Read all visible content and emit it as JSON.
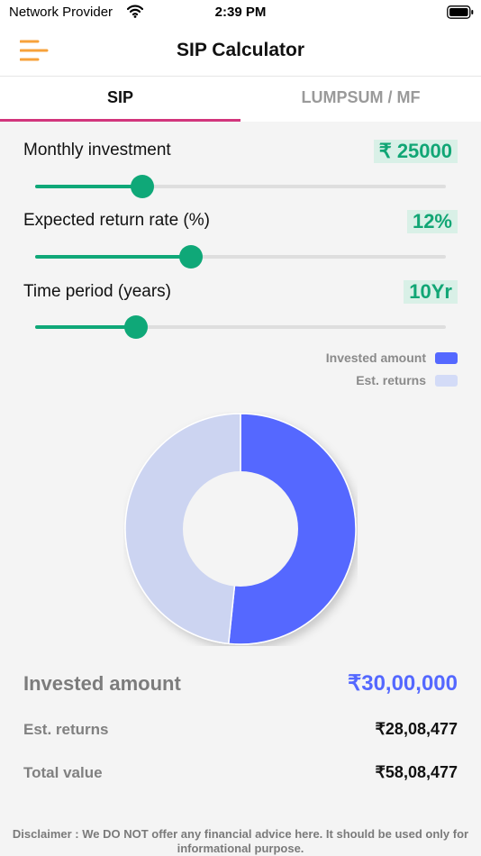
{
  "status_bar": {
    "carrier": "Network Provider",
    "time": "2:39 PM"
  },
  "header": {
    "title": "SIP Calculator",
    "menu_icon": "hamburger-menu-icon",
    "menu_color": "#f7a23b"
  },
  "tabs": [
    {
      "label": "SIP",
      "active": true
    },
    {
      "label": "LUMPSUM / MF",
      "active": false
    }
  ],
  "inputs": {
    "monthly_investment": {
      "label": "Monthly investment",
      "value": "₹ 25000",
      "slider_fraction": 0.26
    },
    "return_rate": {
      "label": "Expected return rate (%)",
      "value": "12%",
      "slider_fraction": 0.38
    },
    "time_period": {
      "label": "Time period (years)",
      "value": "10Yr",
      "slider_fraction": 0.245
    }
  },
  "legend": [
    {
      "label": "Invested amount",
      "color": "#5468ff"
    },
    {
      "label": "Est. returns",
      "color": "#d3dbf7"
    }
  ],
  "chart_data": {
    "type": "pie",
    "labels": [
      "Invested amount",
      "Est. returns"
    ],
    "values": [
      3000000,
      2808477
    ],
    "colors": [
      "#5468ff",
      "#ccd4f1"
    ],
    "legend_position": "top-right"
  },
  "summary": {
    "invested": {
      "label": "Invested amount",
      "value": "₹30,00,000"
    },
    "returns": {
      "label": "Est. returns",
      "value": "₹28,08,477"
    },
    "total": {
      "label": "Total value",
      "value": "₹58,08,477"
    }
  },
  "disclaimer": "Disclaimer : We DO NOT offer any financial advice here. It should be used only for informational purpose.",
  "colors": {
    "accent_green": "#0fa878",
    "tab_indicator": "#d2357c",
    "invested_blue": "#5468ff"
  }
}
